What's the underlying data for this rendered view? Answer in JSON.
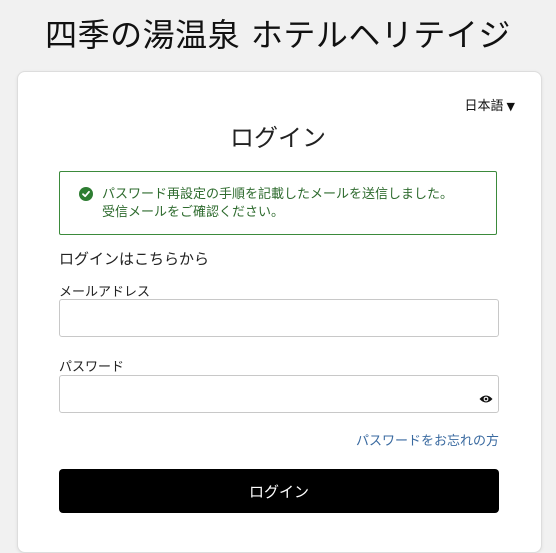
{
  "header": {
    "hotel_name": "四季の湯温泉 ホテルヘリテイジ"
  },
  "language": {
    "selected": "日本語",
    "caret": "▼"
  },
  "login": {
    "title": "ログイン",
    "alert": {
      "icon": "check-circle-icon",
      "line1": "パスワード再設定の手順を記載したメールを送信しました。",
      "line2": "受信メールをご確認ください。",
      "color": "#2e7d32"
    },
    "section_label": "ログインはこちらから",
    "email_label": "メールアドレス",
    "email_value": "",
    "password_label": "パスワード",
    "password_value": "",
    "forgot_link": "パスワードをお忘れの方",
    "submit_label": "ログイン"
  },
  "colors": {
    "primary_button": "#000000",
    "link": "#3a6aa0",
    "success": "#2e7d32"
  }
}
